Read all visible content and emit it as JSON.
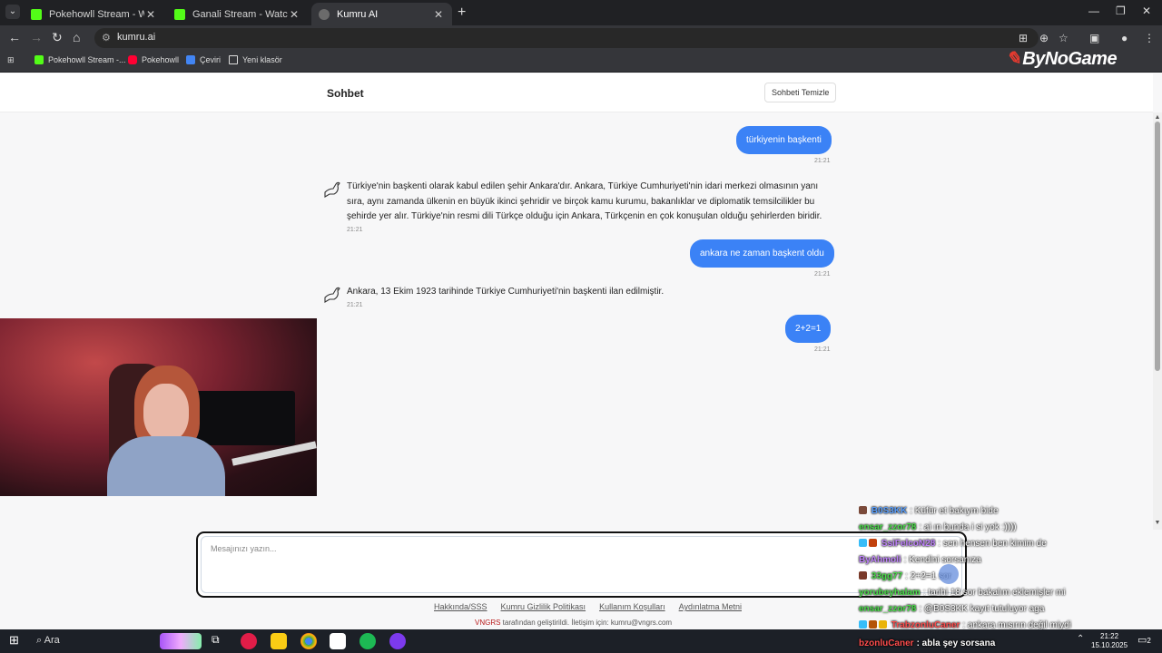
{
  "browser": {
    "tabs": [
      {
        "title": "Pokehowll Stream - Watch Live",
        "favicon": "kick-icon"
      },
      {
        "title": "Ganali Stream - Watch Live on K",
        "favicon": "kick-icon"
      },
      {
        "title": "Kumru AI",
        "favicon": "kumru-icon"
      }
    ],
    "url": "kumru.ai",
    "bookmarks": [
      "Pokehowll Stream -...",
      "Pokehowll",
      "Çeviri",
      "Yeni klasör"
    ],
    "overlay_logo": "ByNoGame"
  },
  "page": {
    "title": "Sohbet",
    "clear_button": "Sohbeti Temizle",
    "input_placeholder": "Mesajınızı yazın...",
    "accent": "#3b82f6"
  },
  "messages": [
    {
      "role": "user",
      "text": "türkiyenin başkenti",
      "time": "21:21"
    },
    {
      "role": "bot",
      "text": "Türkiye'nin başkenti olarak kabul edilen şehir Ankara'dır. Ankara, Türkiye Cumhuriyeti'nin idari merkezi olmasının yanı sıra, aynı zamanda ülkenin en büyük ikinci şehridir ve birçok kamu kurumu, bakanlıklar ve diplomatik temsilcilikler bu şehirde yer alır. Türkiye'nin resmi dili Türkçe olduğu için Ankara, Türkçenin en çok konuşulan olduğu şehirlerden biridir.",
      "time": "21:21"
    },
    {
      "role": "user",
      "text": "ankara ne zaman başkent oldu",
      "time": "21:21"
    },
    {
      "role": "bot",
      "text": "Ankara, 13 Ekim 1923 tarihinde Türkiye Cumhuriyeti'nin başkenti ilan edilmiştir.",
      "time": "21:21"
    },
    {
      "role": "user",
      "text": "2+2=1",
      "time": "21:21"
    }
  ],
  "footer": {
    "links": [
      "Hakkında/SSS",
      "Kumru Gizlilik Politikası",
      "Kullanım Koşulları",
      "Aydınlatma Metni"
    ],
    "brand": "VNGRS",
    "credit": " tarafından geliştirildi. İletişim için: kumru@vngrs.com"
  },
  "chat": [
    {
      "user": "B0S3KK",
      "msg": ": Küfür et bakıym bide",
      "color": "#5aa0ff"
    },
    {
      "user": "ensar_zzor78",
      "msg": ": ai ın bunda i si yok :))))",
      "color": "#4ade4a"
    },
    {
      "user": "SsiFelcoN28",
      "msg": ": sen hensen ben kimim de",
      "color": "#c084fc"
    },
    {
      "user": "ByAhmoli",
      "msg": ": Kendini sorsanıza",
      "color": "#c084fc"
    },
    {
      "user": "33gg77",
      "msg": ": 2+2=1 sor",
      "color": "#4ade4a"
    },
    {
      "user": "yorubeyhalam",
      "msg": ": tarihi 18 sor bakalım eklemişler mi",
      "color": "#4ade4a"
    },
    {
      "user": "ensar_zzor78",
      "msg": ": @B0S3KK kayıt tutuluyor aga",
      "color": "#4ade4a"
    },
    {
      "user": "TrabzonluCaner",
      "msg": ": ankara mısırın değil miydi",
      "color": "#ff4d4d"
    },
    {
      "user": "bzonluCaner",
      "msg": ": abla şey sorsana",
      "color": "#ff4d4d"
    }
  ],
  "taskbar": {
    "search": "Ara",
    "time": "21:22",
    "date": "15.10.2025",
    "notifications": "2"
  }
}
